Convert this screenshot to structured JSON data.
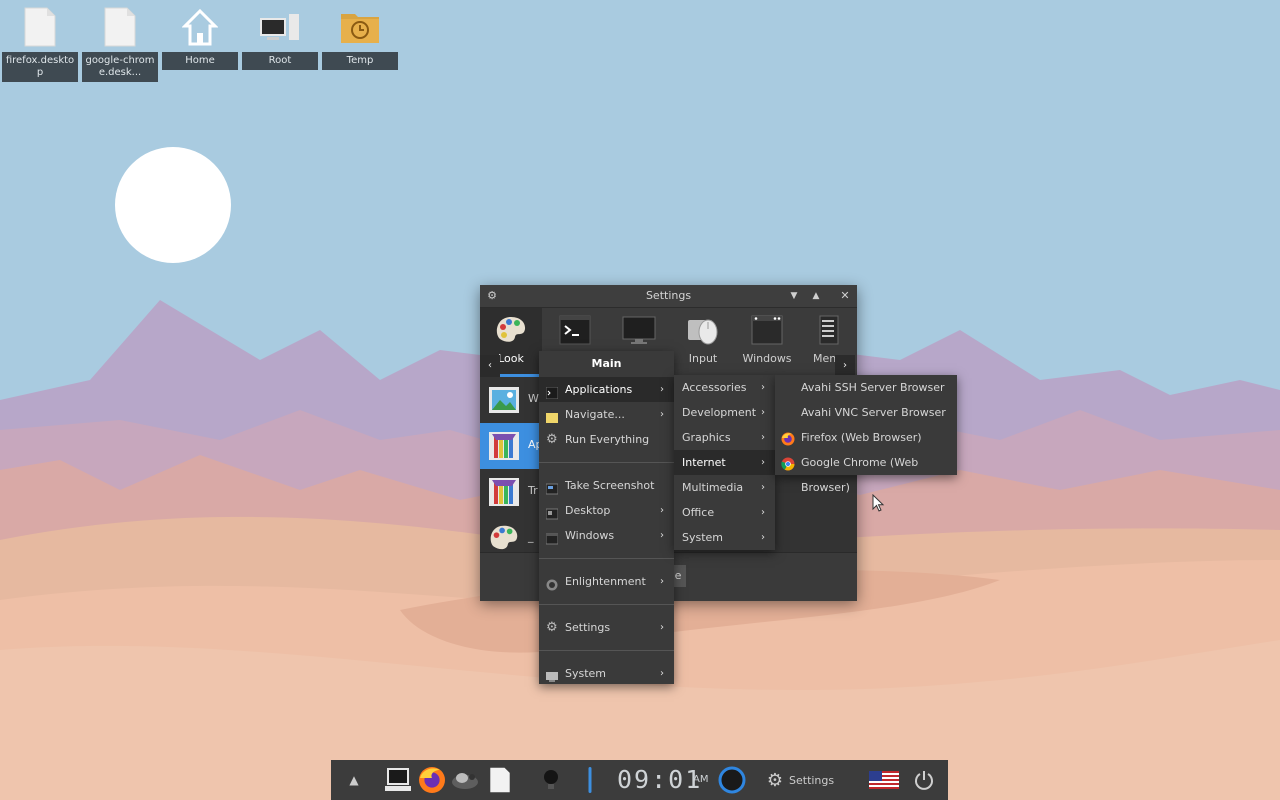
{
  "desktop_icons": [
    {
      "label": "firefox.desktop",
      "icon": "file-icon"
    },
    {
      "label": "google-chrome.desk...",
      "icon": "file-icon"
    },
    {
      "label": "Home",
      "icon": "home-icon"
    },
    {
      "label": "Root",
      "icon": "computer-icon"
    },
    {
      "label": "Temp",
      "icon": "folder-clock-icon"
    }
  ],
  "settings_window": {
    "title": "Settings",
    "tabs": [
      {
        "label": "Look",
        "icon": "palette-icon"
      },
      {
        "label": "",
        "icon": "terminal-icon"
      },
      {
        "label": "",
        "icon": "monitor-icon"
      },
      {
        "label": "Input",
        "icon": "mouse-icon"
      },
      {
        "label": "Windows",
        "icon": "window-icon"
      },
      {
        "label": "Menus",
        "icon": "menus-icon"
      }
    ],
    "list": [
      {
        "label": "W",
        "icon": "wallpaper-icon"
      },
      {
        "label": "Ap",
        "icon": "application-theme-icon"
      },
      {
        "label": "Tr",
        "icon": "transitions-icon"
      },
      {
        "label": "_",
        "icon": "palette-icon"
      }
    ],
    "bottom_partial_text": "e"
  },
  "main_menu": {
    "title": "Main",
    "items": [
      {
        "label": "Applications",
        "icon": "terminal-small-icon",
        "submenu": true,
        "highlighted": true
      },
      {
        "label": "Navigate...",
        "icon": "folder-icon",
        "submenu": true
      },
      {
        "label": "Run Everything",
        "icon": "gear-icon",
        "submenu": false
      },
      {
        "label": "Take Screenshot",
        "icon": "screenshot-icon",
        "submenu": false
      },
      {
        "label": "Desktop",
        "icon": "desktop-icon",
        "submenu": true
      },
      {
        "label": "Windows",
        "icon": "windows-icon",
        "submenu": true
      },
      {
        "label": "Enlightenment",
        "icon": "enlightenment-icon",
        "submenu": true
      },
      {
        "label": "Settings",
        "icon": "gear-icon",
        "submenu": true
      },
      {
        "label": "System",
        "icon": "system-icon",
        "submenu": true
      }
    ]
  },
  "applications_menu": {
    "items": [
      {
        "label": "Accessories"
      },
      {
        "label": "Development"
      },
      {
        "label": "Graphics"
      },
      {
        "label": "Internet",
        "highlighted": true
      },
      {
        "label": "Multimedia"
      },
      {
        "label": "Office"
      },
      {
        "label": "System"
      }
    ]
  },
  "internet_menu": {
    "items": [
      {
        "label": "Avahi SSH Server Browser",
        "icon": ""
      },
      {
        "label": "Avahi VNC Server Browser",
        "icon": ""
      },
      {
        "label": "Firefox (Web Browser)",
        "icon": "firefox-icon"
      },
      {
        "label": "Google Chrome (Web Browser)",
        "icon": "chrome-icon"
      }
    ]
  },
  "taskbar": {
    "clock_time": "09:01",
    "clock_ampm": "AM",
    "settings_label": "Settings",
    "icons": [
      "chevron-up-icon",
      "computer-icon",
      "firefox-icon",
      "gnome-icon",
      "file-icon",
      "bulb-icon",
      "thermometer-icon",
      "circle-icon",
      "gear-icon",
      "us-flag-icon",
      "power-icon"
    ]
  },
  "colors": {
    "accent": "#3d8fe0",
    "menu_bg": "#3a3a3a",
    "sky": "#a9cbe0"
  }
}
